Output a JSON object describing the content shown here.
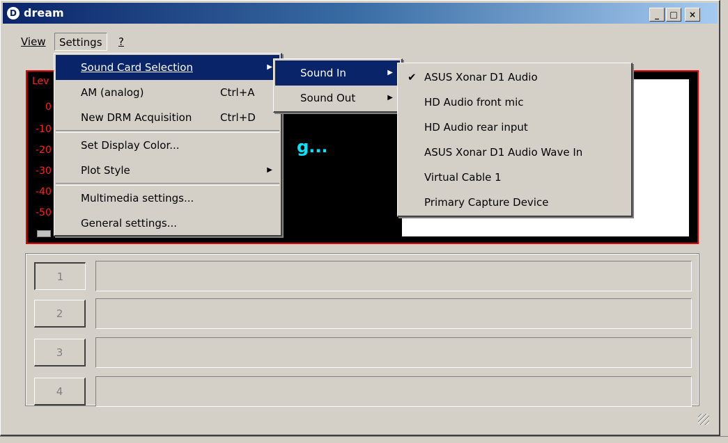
{
  "window": {
    "title": "dream",
    "icon_letter": "D",
    "min": "_",
    "max": "□",
    "close": "×"
  },
  "menubar": {
    "view": "View",
    "settings": "Settings",
    "help": "?"
  },
  "display": {
    "level_label": "Lev",
    "scale": [
      "0",
      "-10",
      "-20",
      "-30",
      "-40",
      "-50"
    ],
    "status_text": "g..."
  },
  "services": [
    {
      "label": "1",
      "selected": true
    },
    {
      "label": "2",
      "selected": false
    },
    {
      "label": "3",
      "selected": false
    },
    {
      "label": "4",
      "selected": false
    }
  ],
  "settings_menu": {
    "items": [
      {
        "label": "Sound Card Selection",
        "shortcut": "",
        "submenu": true,
        "highlighted": true
      },
      {
        "label": "AM (analog)",
        "shortcut": "Ctrl+A"
      },
      {
        "label": "New DRM Acquisition",
        "shortcut": "Ctrl+D"
      },
      {
        "label": "Set Display Color...",
        "shortcut": ""
      },
      {
        "label": "Plot Style",
        "shortcut": "",
        "submenu": true
      },
      {
        "label": "Multimedia settings...",
        "shortcut": ""
      },
      {
        "label": "General settings...",
        "shortcut": ""
      }
    ]
  },
  "sound_menu": {
    "items": [
      {
        "label": "Sound In",
        "submenu": true,
        "highlighted": true
      },
      {
        "label": "Sound Out",
        "submenu": true
      }
    ]
  },
  "sound_in_menu": {
    "items": [
      {
        "label": "ASUS Xonar D1 Audio",
        "checked": true
      },
      {
        "label": "HD Audio front mic"
      },
      {
        "label": "HD Audio rear input"
      },
      {
        "label": "ASUS Xonar D1 Audio Wave In"
      },
      {
        "label": "Virtual Cable 1"
      },
      {
        "label": "Primary Capture Device"
      }
    ]
  },
  "colors": {
    "titlebar": "#0a246a",
    "highlight": "#0a246a",
    "display_border": "#e00000",
    "level_text": "#ff2020",
    "status_text": "#00e5ff"
  }
}
